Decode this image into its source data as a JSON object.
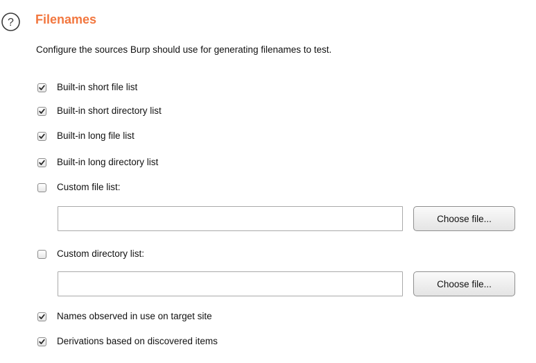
{
  "section": {
    "title": "Filenames",
    "help_icon": "question-circle-icon",
    "description": "Configure the sources Burp should use for generating filenames to test."
  },
  "options": [
    {
      "label": "Built-in short file list",
      "checked": true
    },
    {
      "label": "Built-in short directory list",
      "checked": true
    },
    {
      "label": "Built-in long file list",
      "checked": true
    },
    {
      "label": "Built-in long directory list",
      "checked": true
    },
    {
      "label": "Custom file list:",
      "checked": false
    },
    {
      "label": "Custom directory list:",
      "checked": false
    },
    {
      "label": "Names observed in use on target site",
      "checked": true
    },
    {
      "label": "Derivations based on discovered items",
      "checked": true
    }
  ],
  "custom_file": {
    "value": "",
    "button_label": "Choose file..."
  },
  "custom_directory": {
    "value": "",
    "button_label": "Choose file..."
  },
  "colors": {
    "title": "#f2773f",
    "checkmark": "#2b2b2b"
  }
}
